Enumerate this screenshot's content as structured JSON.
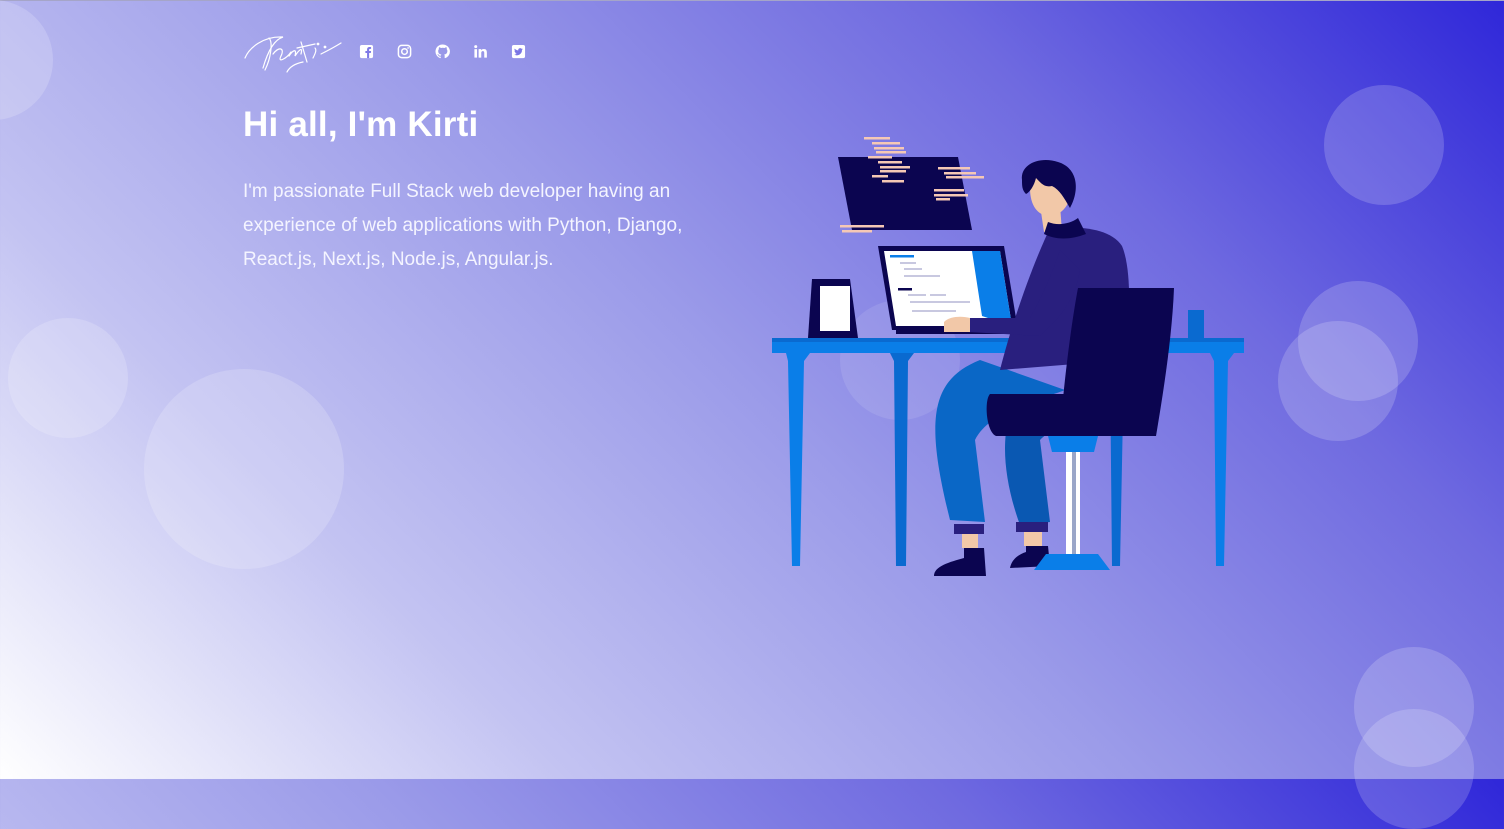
{
  "brand": {
    "logo_text": "Kirti"
  },
  "social": [
    {
      "icon": "facebook-icon"
    },
    {
      "icon": "instagram-icon"
    },
    {
      "icon": "github-icon"
    },
    {
      "icon": "linkedin-icon"
    },
    {
      "icon": "twitter-icon"
    }
  ],
  "hero": {
    "title": "Hi all, I'm Kirti",
    "description": "I'm passionate Full Stack web developer having an experience of web applications with Python, Django, React.js, Next.js, Node.js, Angular.js."
  },
  "colors": {
    "gradient_start": "#ffffff",
    "gradient_end": "#2f27d9",
    "desk_blue": "#0a7ee8",
    "navy": "#0b0550"
  }
}
